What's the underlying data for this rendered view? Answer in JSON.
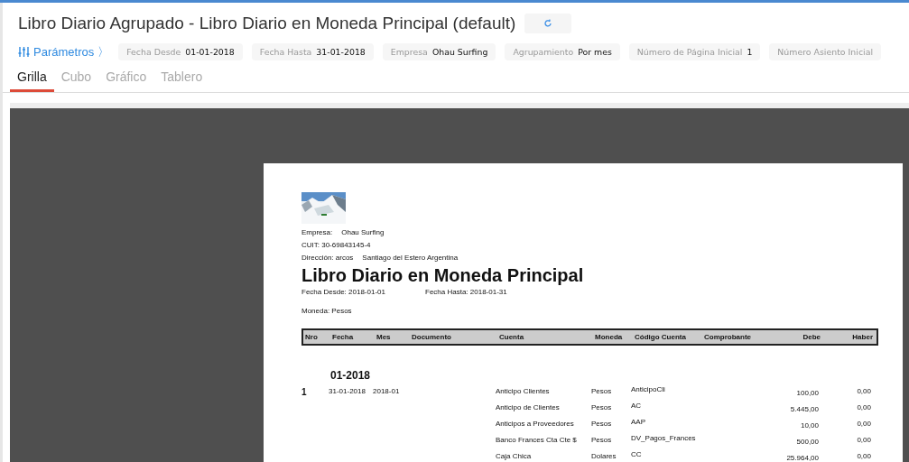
{
  "header": {
    "title": "Libro Diario Agrupado - Libro Diario en Moneda Principal (default)"
  },
  "parameters": {
    "label": "Parámetros",
    "chevron": "〉"
  },
  "filters": [
    {
      "label": "Fecha Desde",
      "value": "01-01-2018"
    },
    {
      "label": "Fecha Hasta",
      "value": "31-01-2018"
    },
    {
      "label": "Empresa",
      "value": "Ohau Surfing"
    },
    {
      "label": "Agrupamiento",
      "value": "Por mes"
    },
    {
      "label": "Número de Página Inicial",
      "value": "1"
    },
    {
      "label": "Número Asiento Inicial"
    }
  ],
  "tabs": [
    {
      "label": "Grilla",
      "selected": true
    },
    {
      "label": "Cubo",
      "selected": false
    },
    {
      "label": "Gráfico",
      "selected": false
    },
    {
      "label": "Tablero",
      "selected": false
    }
  ],
  "report": {
    "company": {
      "label": "Empresa:",
      "value": "Ohau Surfing"
    },
    "cuit": "CUIT: 30-69843145-4",
    "address": "Dirección: arcos",
    "location": "Santiago del Estero Argentina",
    "title": "Libro Diario en Moneda Principal",
    "date_from": "Fecha Desde: 2018-01-01",
    "date_to": "Fecha Hasta: 2018-01-31",
    "currency": "Moneda: Pesos",
    "columns": [
      "Nro",
      "Fecha",
      "Mes",
      "Documento",
      "Cuenta",
      "Moneda",
      "Código Cuenta",
      "Comprobante",
      "Debe",
      "Haber"
    ],
    "group": "01-2018",
    "entries": [
      {
        "nro": "1",
        "fecha": "31-01-2018",
        "mes": "2018-01",
        "lines": [
          {
            "cuenta": "Anticipo Clientes",
            "moneda": "Pesos",
            "codigo": "AnticipoCli",
            "debe": "100,00",
            "haber": "0,00"
          },
          {
            "cuenta": "Anticipo de Clientes",
            "moneda": "Pesos",
            "codigo": "AC",
            "debe": "5.445,00",
            "haber": "0,00"
          },
          {
            "cuenta": "Anticipos a Proveedores",
            "moneda": "Pesos",
            "codigo": "AAP",
            "debe": "10,00",
            "haber": "0,00"
          },
          {
            "cuenta": "Banco Frances Cta Cte $",
            "moneda": "Pesos",
            "codigo": "DV_Pagos_Frances",
            "debe": "500,00",
            "haber": "0,00"
          },
          {
            "cuenta": "Caja Chica",
            "moneda": "Dolares",
            "codigo": "CC",
            "debe": "25.964,00",
            "haber": "0,00"
          }
        ]
      }
    ]
  }
}
